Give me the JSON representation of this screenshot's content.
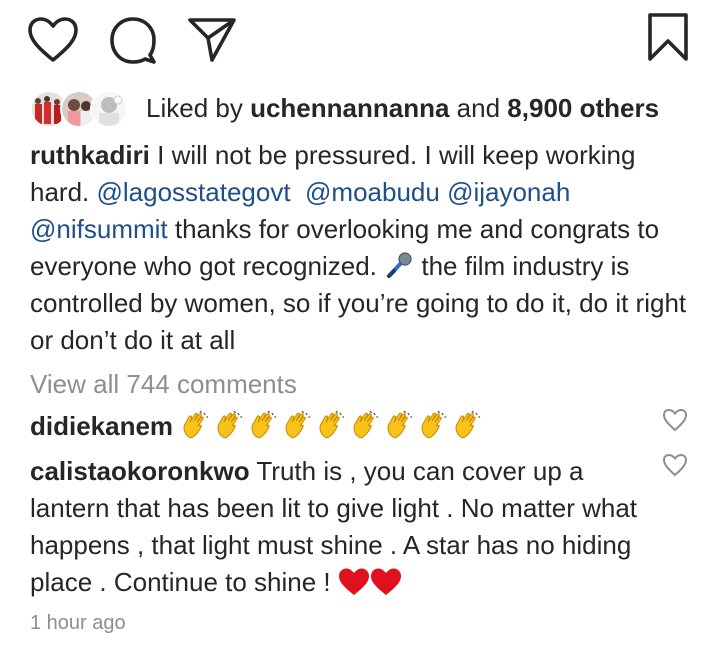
{
  "actions": {
    "like_icon": "heart-outline-icon",
    "comment_icon": "comment-bubble-icon",
    "share_icon": "paper-plane-icon",
    "save_icon": "bookmark-icon"
  },
  "likes": {
    "prefix": "Liked by",
    "user": "uchennannanna",
    "joiner": "and",
    "count_text": "8,900 others"
  },
  "caption": {
    "username": "ruthkadiri",
    "text_1": " I will not be pressured. I will keep working hard. ",
    "mention_1": "@lagosstategovt",
    "mention_2": "@moabudu",
    "mention_3": "@ijayonah",
    "mention_4": "@nifsummit",
    "text_2": " thanks for overlooking me and congrats to everyone who got recognized. ",
    "emoji_mic": "microphone-emoji",
    "text_3": " the film industry is controlled by women, so if you’re going to do it, do it right or don’t do it at all"
  },
  "view_all_comments": "View all 744 comments",
  "comments": [
    {
      "username": "didiekanem",
      "emoji": "clapping-hands-emoji",
      "emoji_count": 9
    },
    {
      "username": "calistaokoronkwo",
      "text": " Truth is , you can cover up a lantern that has been lit to give light . No matter what happens , that light must shine . A star has no hiding place . Continue to shine ! ",
      "emoji": "red-heart-emoji",
      "emoji_count": 2
    }
  ],
  "timestamp": "1 hour ago",
  "colors": {
    "text": "#262626",
    "muted": "#8e8e8e",
    "mention": "#1e4f8a",
    "heart_red": "#e0101c",
    "clap_yellow": "#f7c21a"
  }
}
